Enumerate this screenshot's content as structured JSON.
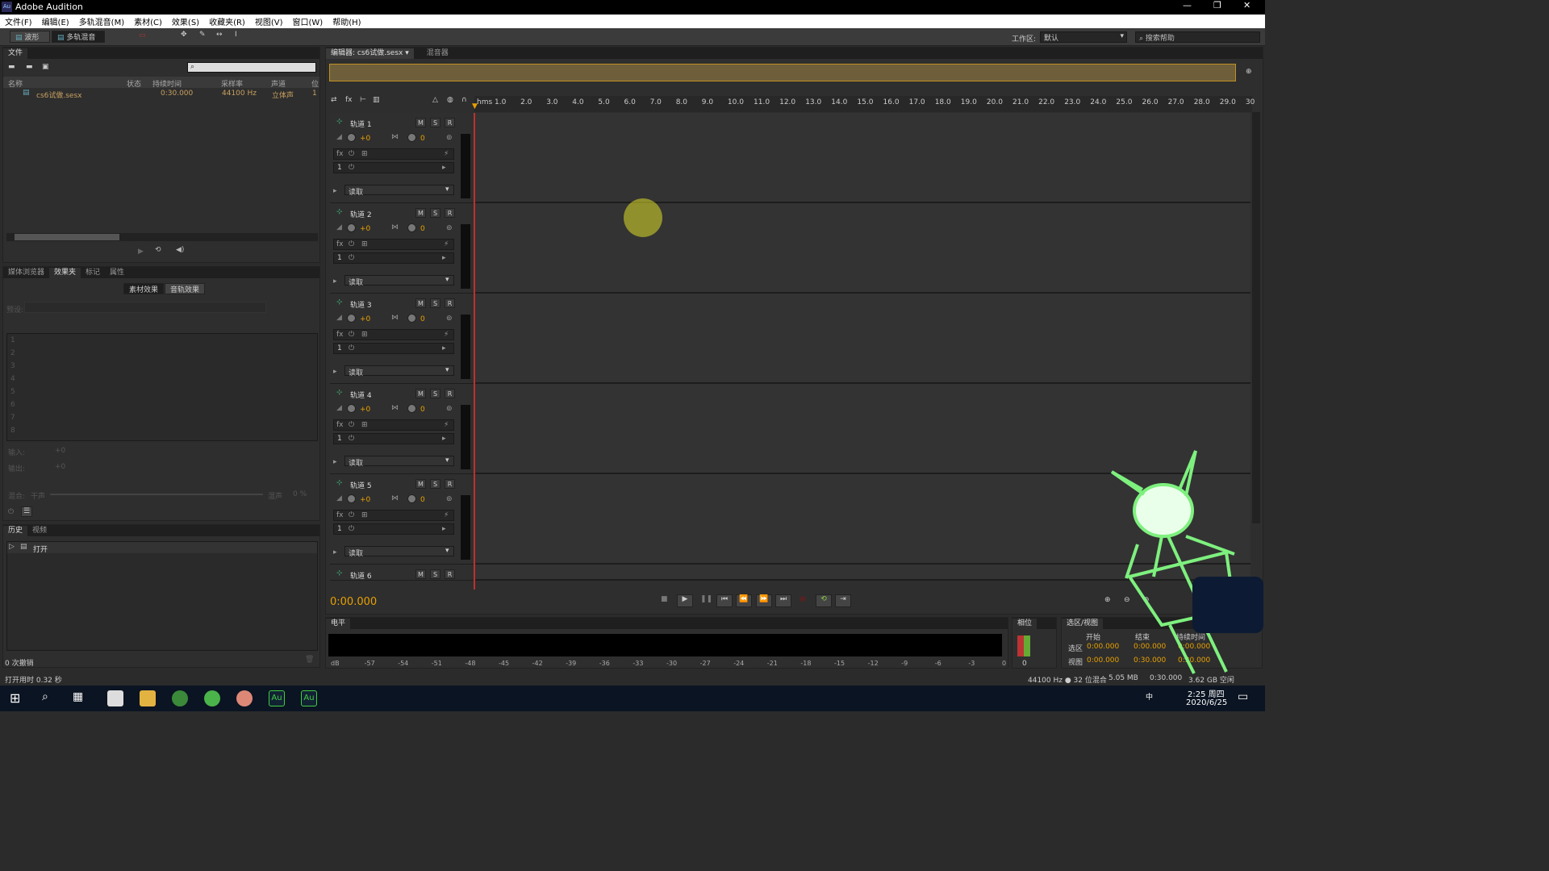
{
  "app_title": "Adobe Audition",
  "app_icon": "Au",
  "menu": [
    "文件(F)",
    "编辑(E)",
    "多轨混音(M)",
    "素材(C)",
    "效果(S)",
    "收藏夹(R)",
    "视图(V)",
    "窗口(W)",
    "帮助(H)"
  ],
  "toolbar": {
    "waveform_label": "波形",
    "multitrack_label": "多轨混音",
    "workspace_label": "工作区:",
    "workspace_value": "默认",
    "search_placeholder": "搜索帮助"
  },
  "files_panel": {
    "tab": "文件",
    "columns": [
      "名称",
      "状态",
      "持续时间",
      "采样率",
      "声道",
      "位"
    ],
    "rows": [
      {
        "name": "cs6试做.sesx",
        "duration": "0:30.000",
        "sample_rate": "44100 Hz",
        "channels": "立体声",
        "bits": "1"
      }
    ]
  },
  "effects_panel": {
    "tabs": [
      "媒体浏览器",
      "效果夹",
      "标记",
      "属性"
    ],
    "subtabs": [
      "素材效果",
      "音轨效果"
    ],
    "preset_label": "预设:",
    "slots": [
      "1",
      "2",
      "3",
      "4",
      "5",
      "6",
      "7",
      "8"
    ],
    "input_label": "输入:",
    "input_value": "+0",
    "output_label": "输出:",
    "output_value": "+0",
    "mix_label": "混合:",
    "mix_left": "干声",
    "mix_right": "湿声",
    "mix_value": "0 %"
  },
  "history_panel": {
    "tabs": [
      "历史",
      "视频"
    ],
    "items": [
      "打开"
    ],
    "undo_count": "0 次撤销"
  },
  "status_left": "打开用时 0.32 秒",
  "editor": {
    "tab": "编辑器: cs6试做.sesx",
    "tab2": "混音器",
    "ruler_unit": "hms",
    "ruler": [
      "1.0",
      "2.0",
      "3.0",
      "4.0",
      "5.0",
      "6.0",
      "7.0",
      "8.0",
      "9.0",
      "10.0",
      "11.0",
      "12.0",
      "13.0",
      "14.0",
      "15.0",
      "16.0",
      "17.0",
      "18.0",
      "19.0",
      "20.0",
      "21.0",
      "22.0",
      "23.0",
      "24.0",
      "25.0",
      "26.0",
      "27.0",
      "28.0",
      "29.0",
      "30"
    ]
  },
  "tracks": [
    {
      "name": "轨道 1",
      "volume": "+0",
      "pan": "0",
      "slot": "1",
      "mode": "读取"
    },
    {
      "name": "轨道 2",
      "volume": "+0",
      "pan": "0",
      "slot": "1",
      "mode": "读取"
    },
    {
      "name": "轨道 3",
      "volume": "+0",
      "pan": "0",
      "slot": "1",
      "mode": "读取"
    },
    {
      "name": "轨道 4",
      "volume": "+0",
      "pan": "0",
      "slot": "1",
      "mode": "读取"
    },
    {
      "name": "轨道 5",
      "volume": "+0",
      "pan": "0",
      "slot": "1",
      "mode": "读取"
    },
    {
      "name": "轨道 6"
    }
  ],
  "track_buttons": {
    "m": "M",
    "s": "S",
    "r": "R"
  },
  "time_display": "0:00.000",
  "level_panel": {
    "tab": "电平",
    "scale": [
      "dB",
      "-57",
      "-54",
      "-51",
      "-48",
      "-45",
      "-42",
      "-39",
      "-36",
      "-33",
      "-30",
      "-27",
      "-24",
      "-21",
      "-18",
      "-15",
      "-12",
      "-9",
      "-6",
      "-3",
      "0"
    ]
  },
  "phase_tab": "相位",
  "phase_zero": "0",
  "selection_panel": {
    "tab": "选区/视图",
    "col_start": "开始",
    "col_end": "结束",
    "col_duration": "持续时间",
    "rows": [
      {
        "label": "选区",
        "start": "0:00.000",
        "end": "0:00.000",
        "duration": "0:00.000"
      },
      {
        "label": "视图",
        "start": "0:00.000",
        "end": "0:30.000",
        "duration": "0:30.000"
      }
    ]
  },
  "status_right": {
    "format": "44100 Hz ● 32 位混合",
    "size": "5.05 MB",
    "duration": "0:30.000",
    "free": "3.62 GB 空闲"
  },
  "taskbar": {
    "time": "2:25 周四",
    "date": "2020/6/25",
    "ime": "中"
  }
}
